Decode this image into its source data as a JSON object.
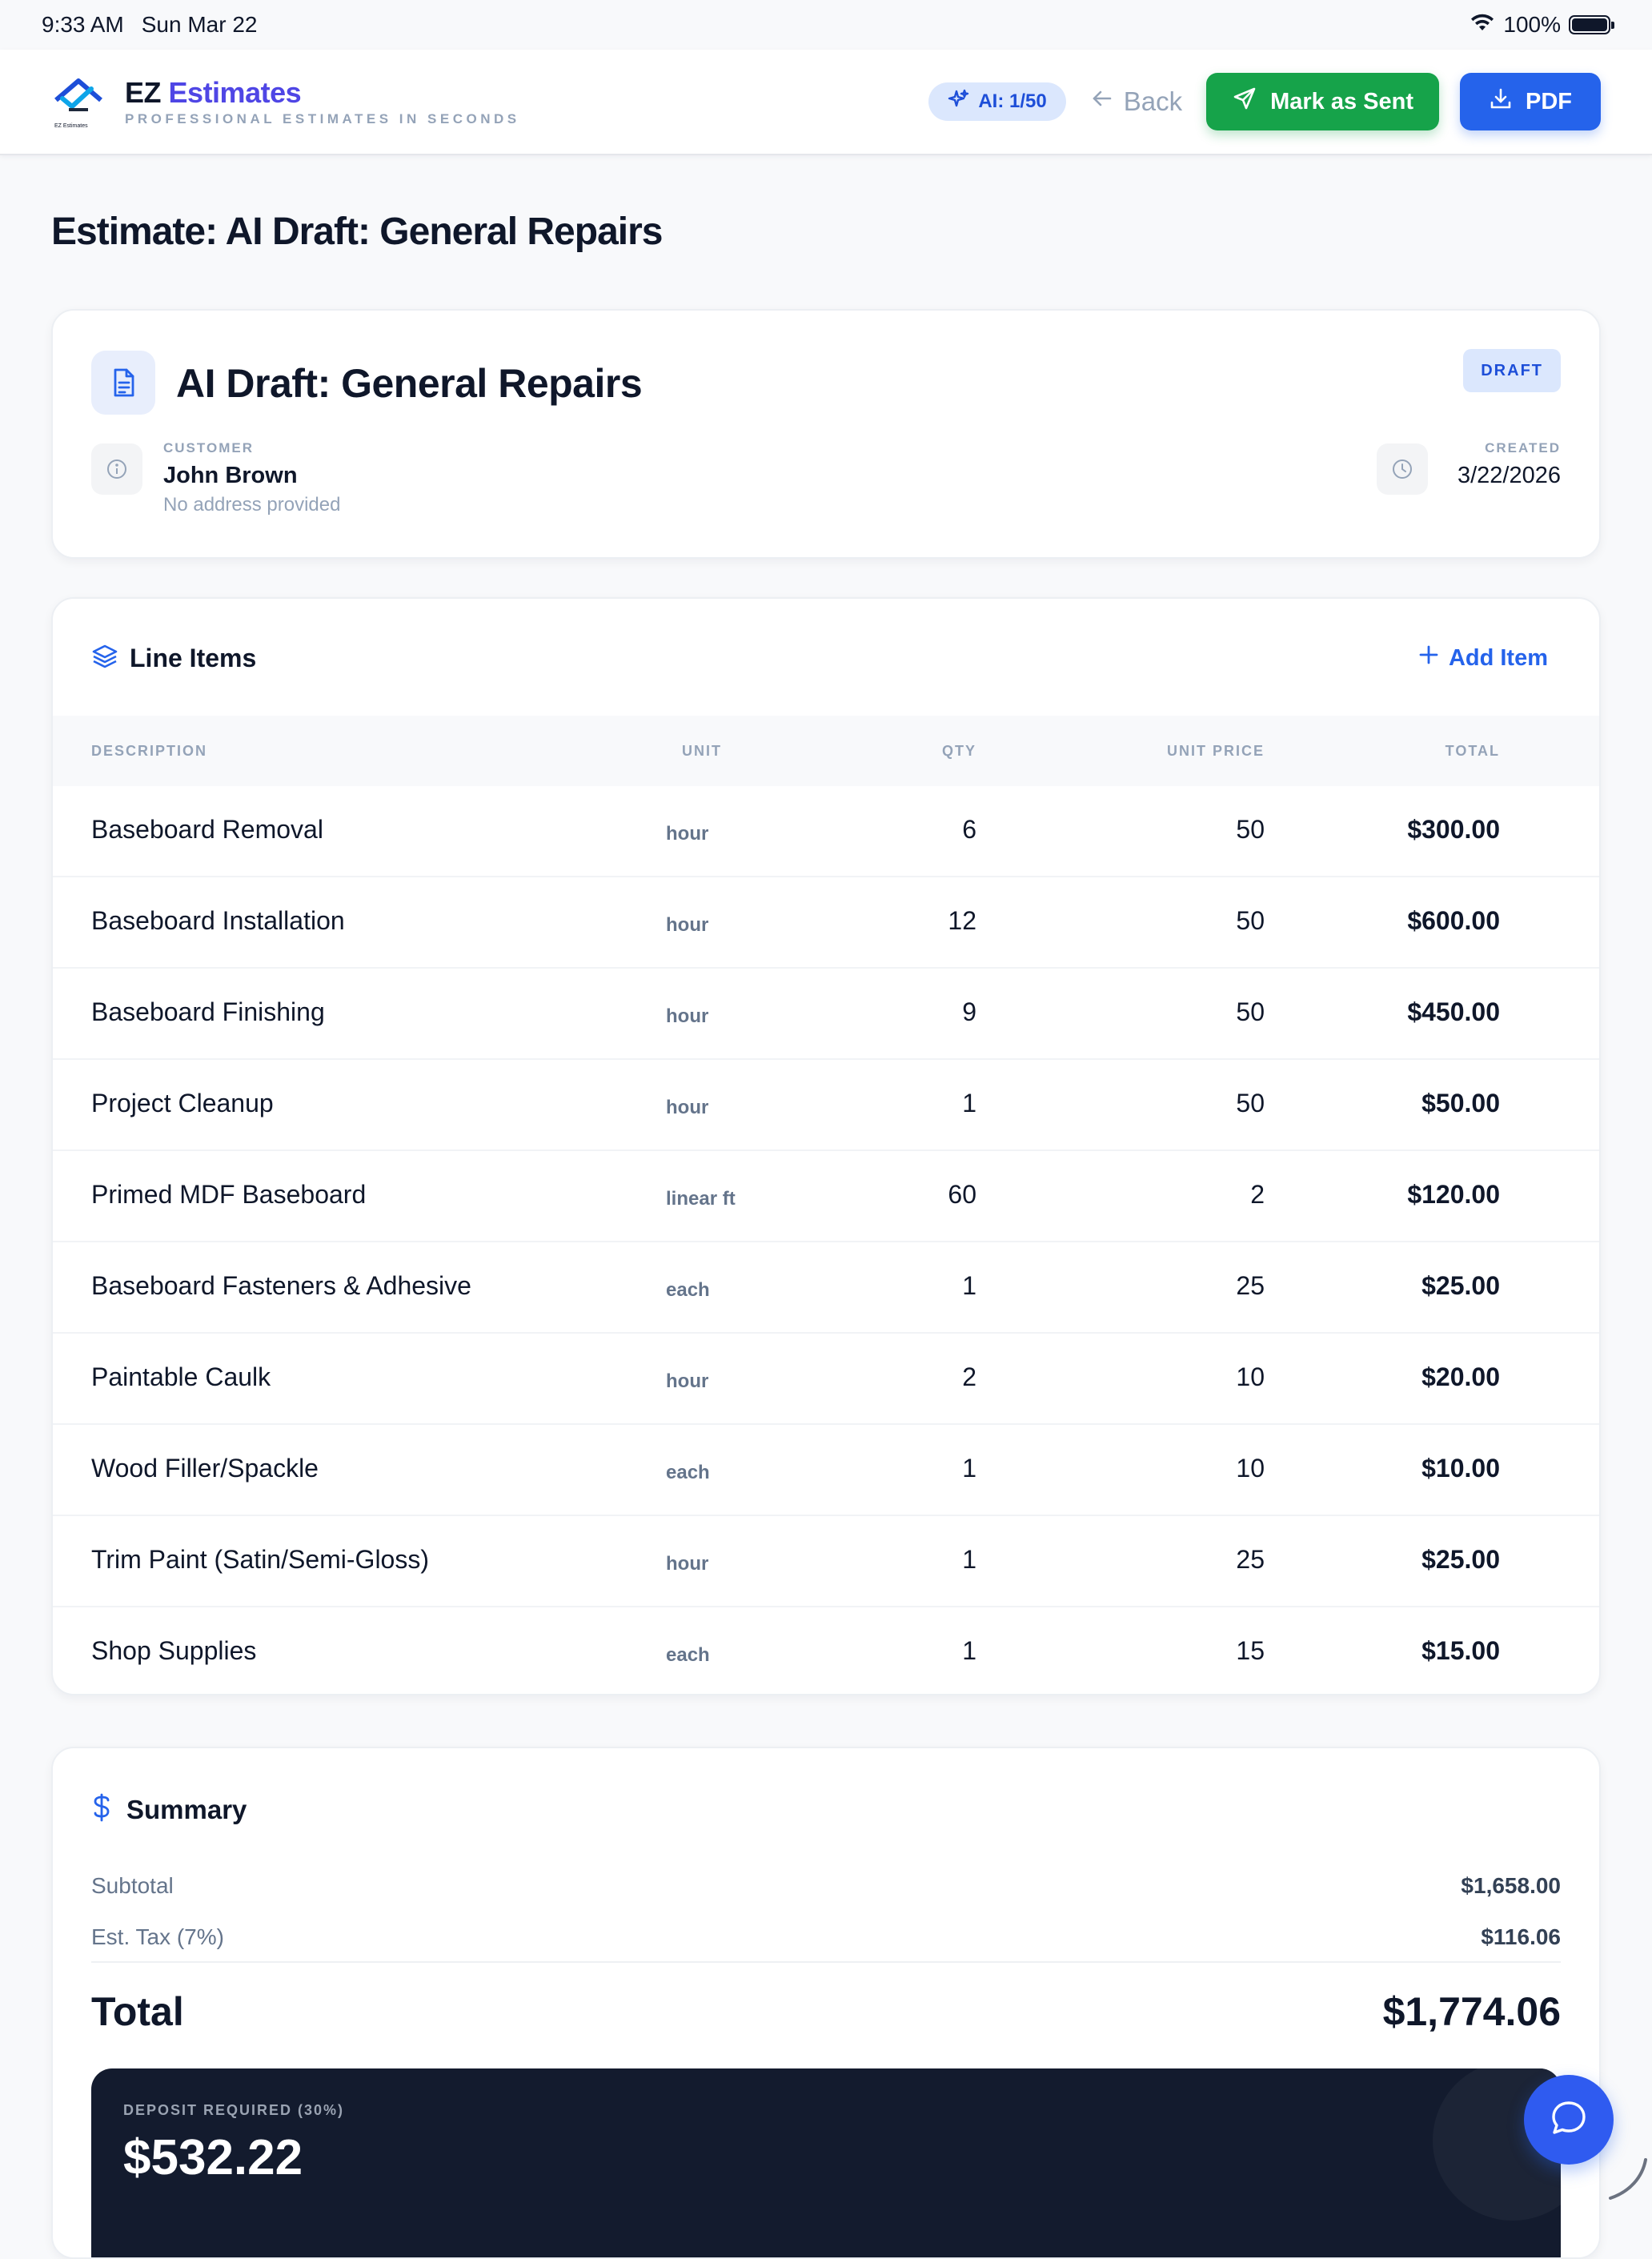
{
  "status_bar": {
    "time": "9:33 AM",
    "date": "Sun Mar 22",
    "battery": "100%"
  },
  "header": {
    "logo_caption": "EZ Estimates",
    "brand_prefix": "EZ",
    "brand_name": "Estimates",
    "tagline": "PROFESSIONAL ESTIMATES IN SECONDS",
    "ai_usage": "AI: 1/50",
    "back_label": "Back",
    "mark_sent_label": "Mark as Sent",
    "pdf_label": "PDF"
  },
  "page_title": "Estimate: AI Draft: General Repairs",
  "estimate": {
    "name": "AI Draft: General Repairs",
    "status": "DRAFT",
    "customer_label": "CUSTOMER",
    "customer_name": "John Brown",
    "customer_address": "No address provided",
    "created_label": "CREATED",
    "created_date": "3/22/2026"
  },
  "line_items": {
    "title": "Line Items",
    "add_label": "Add Item",
    "columns": {
      "description": "DESCRIPTION",
      "unit": "UNIT",
      "qty": "QTY",
      "unit_price": "UNIT PRICE",
      "total": "TOTAL"
    },
    "rows": [
      {
        "description": "Baseboard Removal",
        "unit": "hour",
        "qty": "6",
        "unit_price": "50",
        "total": "$300.00"
      },
      {
        "description": "Baseboard Installation",
        "unit": "hour",
        "qty": "12",
        "unit_price": "50",
        "total": "$600.00"
      },
      {
        "description": "Baseboard Finishing",
        "unit": "hour",
        "qty": "9",
        "unit_price": "50",
        "total": "$450.00"
      },
      {
        "description": "Project Cleanup",
        "unit": "hour",
        "qty": "1",
        "unit_price": "50",
        "total": "$50.00"
      },
      {
        "description": "Primed MDF Baseboard",
        "unit": "linear ft",
        "qty": "60",
        "unit_price": "2",
        "total": "$120.00"
      },
      {
        "description": "Baseboard Fasteners & Adhesive",
        "unit": "each",
        "qty": "1",
        "unit_price": "25",
        "total": "$25.00"
      },
      {
        "description": "Paintable Caulk",
        "unit": "hour",
        "qty": "2",
        "unit_price": "10",
        "total": "$20.00"
      },
      {
        "description": "Wood Filler/Spackle",
        "unit": "each",
        "qty": "1",
        "unit_price": "10",
        "total": "$10.00"
      },
      {
        "description": "Trim Paint (Satin/Semi-Gloss)",
        "unit": "hour",
        "qty": "1",
        "unit_price": "25",
        "total": "$25.00"
      },
      {
        "description": "Shop Supplies",
        "unit": "each",
        "qty": "1",
        "unit_price": "15",
        "total": "$15.00"
      }
    ]
  },
  "summary": {
    "title": "Summary",
    "subtotal_label": "Subtotal",
    "subtotal": "$1,658.00",
    "tax_label": "Est. Tax (7%)",
    "tax": "$116.06",
    "total_label": "Total",
    "total": "$1,774.06",
    "deposit_label": "DEPOSIT REQUIRED (30%)",
    "deposit": "$532.22"
  },
  "colors": {
    "accent": "#2563eb",
    "brand": "#4f46e5",
    "success": "#16a34a",
    "dark": "#131b2e"
  },
  "icons": [
    "wifi-icon",
    "battery-icon",
    "logo-icon",
    "sparkles-icon",
    "arrow-left-icon",
    "send-icon",
    "download-icon",
    "document-icon",
    "info-icon",
    "clock-icon",
    "layers-icon",
    "plus-icon",
    "dollar-icon",
    "chat-icon"
  ]
}
